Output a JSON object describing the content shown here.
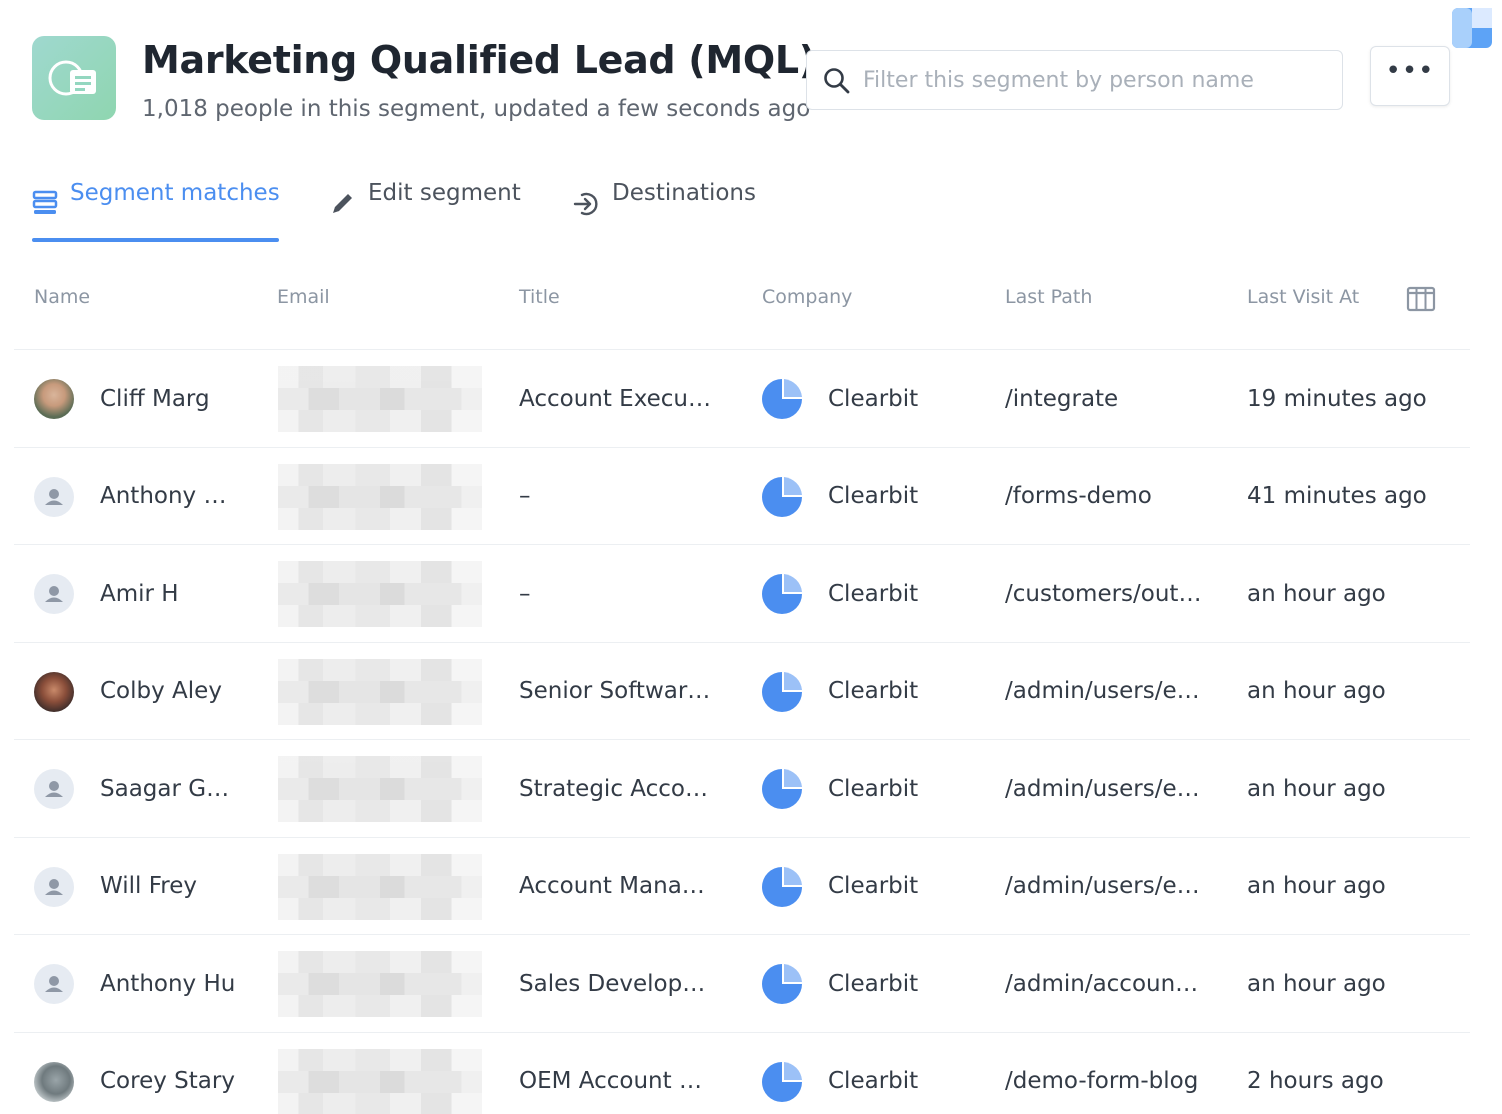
{
  "header": {
    "title": "Marketing Qualified Lead (MQL)",
    "subtitle": "1,018 people in this segment, updated a few seconds ago",
    "search_placeholder": "Filter this segment by person name",
    "more_label": "•••"
  },
  "tabs": [
    {
      "label": "Segment matches",
      "icon": "list-icon",
      "active": true
    },
    {
      "label": "Edit segment",
      "icon": "pencil-icon",
      "active": false
    },
    {
      "label": "Destinations",
      "icon": "exit-arrow-icon",
      "active": false
    }
  ],
  "table": {
    "columns": [
      "Name",
      "Email",
      "Title",
      "Company",
      "Last Path",
      "Last Visit At"
    ],
    "rows": [
      {
        "name": "Cliff Marg",
        "avatar": "photo",
        "title": "Account Execu…",
        "company": "Clearbit",
        "last_path": "/integrate",
        "last_visit": "19 minutes ago"
      },
      {
        "name": "Anthony …",
        "avatar": "default",
        "title": "–",
        "company": "Clearbit",
        "last_path": "/forms-demo",
        "last_visit": "41 minutes ago"
      },
      {
        "name": "Amir H",
        "avatar": "default",
        "title": "–",
        "company": "Clearbit",
        "last_path": "/customers/out…",
        "last_visit": "an hour ago"
      },
      {
        "name": "Colby Aley",
        "avatar": "photo",
        "title": "Senior Softwar…",
        "company": "Clearbit",
        "last_path": "/admin/users/e…",
        "last_visit": "an hour ago"
      },
      {
        "name": "Saagar G…",
        "avatar": "default",
        "title": "Strategic Acco…",
        "company": "Clearbit",
        "last_path": "/admin/users/e…",
        "last_visit": "an hour ago"
      },
      {
        "name": "Will Frey",
        "avatar": "default",
        "title": "Account Mana…",
        "company": "Clearbit",
        "last_path": "/admin/users/e…",
        "last_visit": "an hour ago"
      },
      {
        "name": "Anthony Hu",
        "avatar": "default",
        "title": "Sales Develop…",
        "company": "Clearbit",
        "last_path": "/admin/accoun…",
        "last_visit": "an hour ago"
      },
      {
        "name": "Corey Stary",
        "avatar": "photo",
        "title": "OEM Account …",
        "company": "Clearbit",
        "last_path": "/demo-form-blog",
        "last_visit": "2 hours ago"
      }
    ]
  },
  "colors": {
    "accent": "#4b8ef0",
    "segment_icon": "#94d7c0",
    "company_logo": "#4b8ef0"
  }
}
